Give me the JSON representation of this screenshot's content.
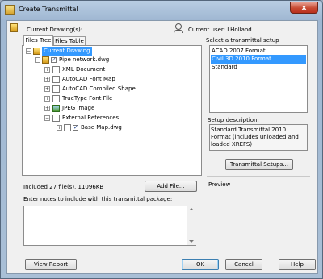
{
  "window": {
    "title": "Create Transmittal",
    "close_label": "x"
  },
  "header": {
    "current_drawings_label": "Current Drawing(s):",
    "current_user_label": "Current user: LHolland"
  },
  "tabs": [
    {
      "label": "Files Tree"
    },
    {
      "label": "Files Table"
    }
  ],
  "tree": {
    "root": "Current Drawing",
    "drawing": "Pipe network.dwg",
    "children": [
      "XML Document",
      "AutoCAD Font Map",
      "AutoCAD Compiled Shape",
      "TrueType Font File",
      "JPEG Image",
      "External References"
    ],
    "xref": "Base Map.dwg"
  },
  "summary": {
    "included": "Included 27 file(s), 11096KB",
    "add_file": "Add File..."
  },
  "notes": {
    "label": "Enter notes to include with this transmittal package:",
    "value": ""
  },
  "setup": {
    "label": "Select a transmittal setup",
    "items": [
      "ACAD 2007 Format",
      "Civil 3D 2010 Format",
      "Standard"
    ],
    "selected": "Civil 3D 2010 Format",
    "description_label": "Setup description:",
    "description": "Standard Transmittal 2010 Format (includes unloaded and loaded XREFS)",
    "setups_button": "Transmittal Setups...",
    "preview_label": "Preview"
  },
  "buttons": {
    "view_report": "View Report",
    "ok": "OK",
    "cancel": "Cancel",
    "help": "Help"
  }
}
